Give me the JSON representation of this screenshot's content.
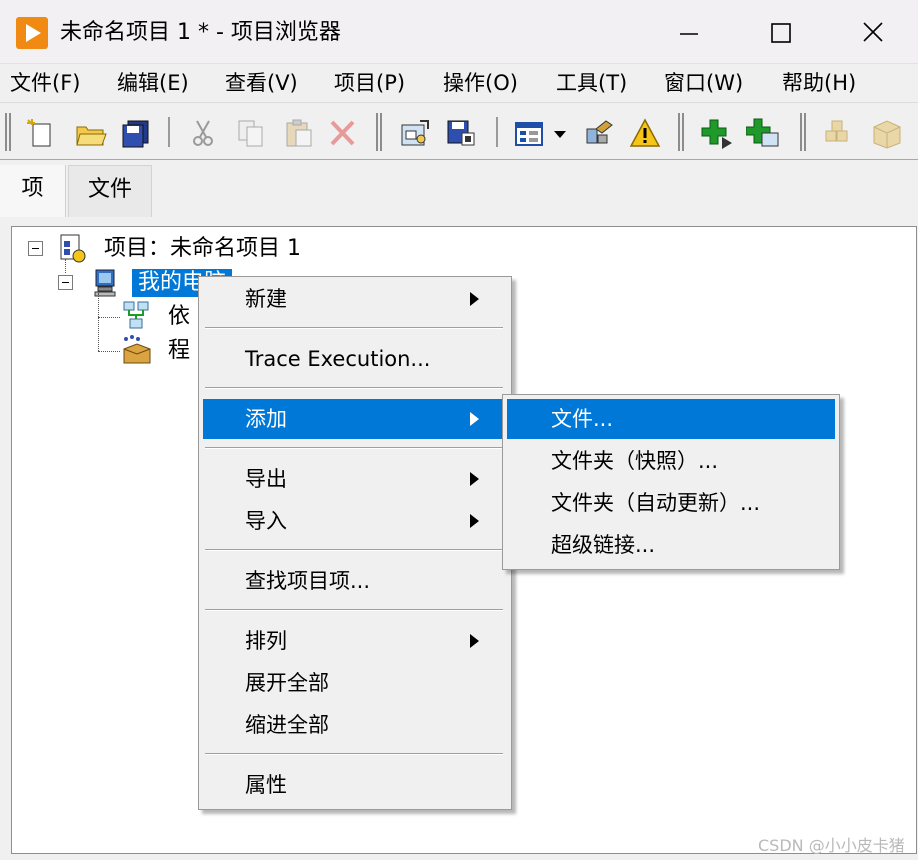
{
  "window": {
    "title": "未命名项目 1 * - 项目浏览器",
    "accent": "#f08a12"
  },
  "menubar": {
    "items": [
      {
        "label": "文件(F)"
      },
      {
        "label": "编辑(E)"
      },
      {
        "label": "查看(V)"
      },
      {
        "label": "项目(P)"
      },
      {
        "label": "操作(O)"
      },
      {
        "label": "工具(T)"
      },
      {
        "label": "窗口(W)"
      },
      {
        "label": "帮助(H)"
      }
    ]
  },
  "toolbar": {
    "icons": [
      "new-icon",
      "open-icon",
      "save-all-icon",
      "cut-icon",
      "copy-icon",
      "paste-icon",
      "delete-icon",
      "build-icon",
      "save-project-icon",
      "view-icon",
      "dropdown-icon",
      "resolve-icon",
      "warning-icon",
      "add-item-icon",
      "add-folder-icon",
      "package-icon",
      "box-icon"
    ]
  },
  "tabs": [
    {
      "label": "项",
      "active": true
    },
    {
      "label": "文件",
      "active": false
    }
  ],
  "tree": {
    "root": {
      "label": "项目：未命名项目 1"
    },
    "computer": {
      "label": "我的电脑"
    },
    "child1": {
      "label": "依"
    },
    "child2": {
      "label": "程"
    }
  },
  "context_menu": {
    "items": [
      {
        "label": "新建",
        "submenu": true
      },
      {
        "label": "Trace Execution...",
        "submenu": false
      },
      {
        "label": "添加",
        "submenu": true,
        "highlighted": true
      },
      {
        "label": "导出",
        "submenu": true
      },
      {
        "label": "导入",
        "submenu": true
      },
      {
        "label": "查找项目项...",
        "submenu": false
      },
      {
        "label": "排列",
        "submenu": true
      },
      {
        "label": "展开全部",
        "submenu": false
      },
      {
        "label": "缩进全部",
        "submenu": false
      },
      {
        "label": "属性",
        "submenu": false
      }
    ]
  },
  "submenu_add": {
    "items": [
      {
        "label": "文件...",
        "highlighted": true
      },
      {
        "label": "文件夹（快照）..."
      },
      {
        "label": "文件夹（自动更新）..."
      },
      {
        "label": "超级链接..."
      }
    ]
  },
  "colors": {
    "selection": "#0078d7",
    "menu_bg": "#f0f0f0"
  },
  "watermark": "CSDN @小小皮卡猪"
}
